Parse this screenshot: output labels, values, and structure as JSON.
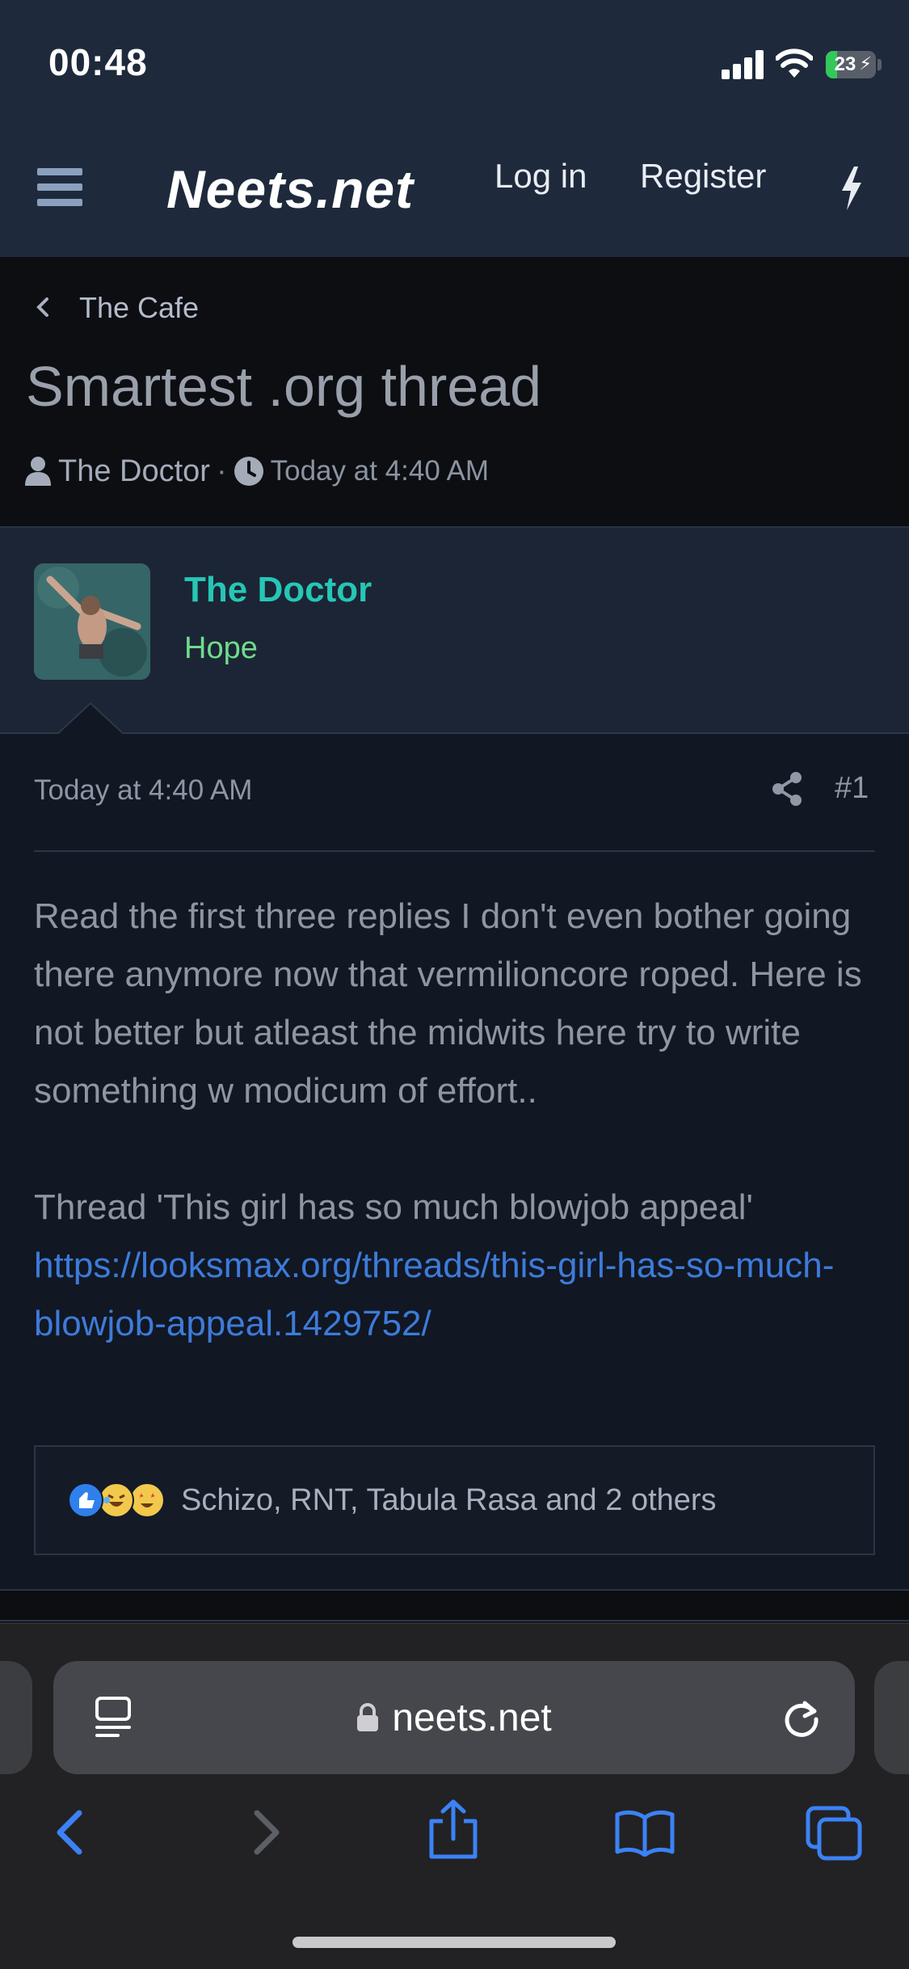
{
  "status_bar": {
    "time": "00:48",
    "battery": "23",
    "battery_level": 0.23
  },
  "nav": {
    "logo": "Neets.net",
    "login": "Log in",
    "register": "Register"
  },
  "thread": {
    "breadcrumb": "The Cafe",
    "title": "Smartest .org thread",
    "author": "The Doctor",
    "separator": "·",
    "date": "Today at 4:40 AM"
  },
  "post": {
    "author": "The Doctor",
    "author_title": "Hope",
    "date": "Today at 4:40 AM",
    "number": "#1",
    "paragraph1": "Read the first three replies I don't even bother going there anymore now that vermilioncore roped. Here is not better but atleast the midwits here try to write something w modicum of effort..",
    "paragraph2": "Thread 'This girl has so much blowjob appeal'",
    "link": "https://looksmax.org/threads/this-girl-has-so-much-blowjob-appeal.1429752/",
    "reactions": "Schizo, RNT, Tabula Rasa and 2 others"
  },
  "browser": {
    "url": "neets.net"
  },
  "colors": {
    "accent": "#26c6b6",
    "user_title": "#6fdc8c",
    "link": "#3d7bd9",
    "header_bg": "#1e2a3c",
    "ios_blue": "#3b82f6"
  }
}
